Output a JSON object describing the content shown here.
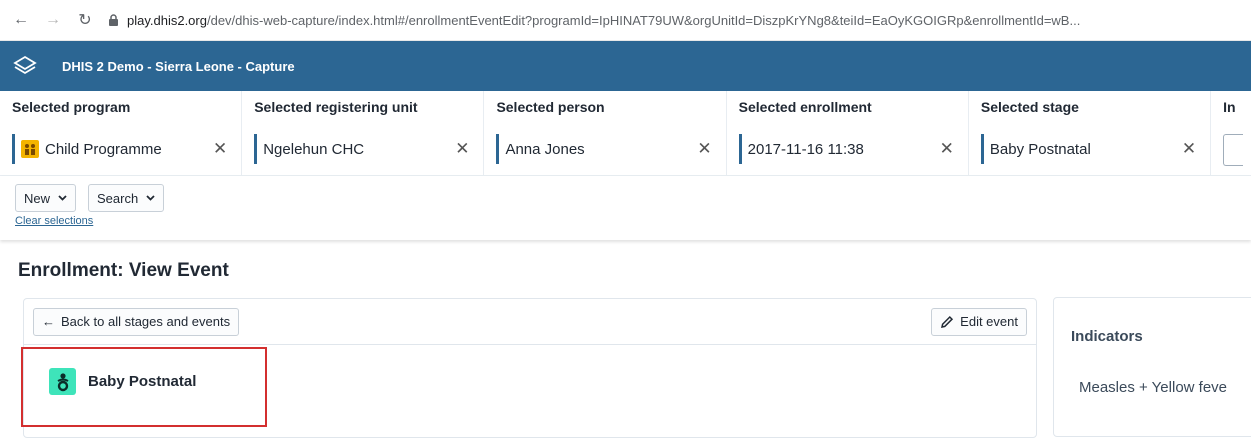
{
  "browser": {
    "url_host": "play.dhis2.org",
    "url_path": "/dev/dhis-web-capture/index.html#/enrollmentEventEdit?programId=IpHINAT79UW&orgUnitId=DiszpKrYNg8&teiId=EaOyKGOIGRp&enrollmentId=wB..."
  },
  "header": {
    "title": "DHIS 2 Demo - Sierra Leone - Capture"
  },
  "selections": [
    {
      "label": "Selected program",
      "value": "Child Programme"
    },
    {
      "label": "Selected registering unit",
      "value": "Ngelehun CHC"
    },
    {
      "label": "Selected person",
      "value": "Anna Jones"
    },
    {
      "label": "Selected enrollment",
      "value": "2017-11-16 11:38"
    },
    {
      "label": "Selected stage",
      "value": "Baby Postnatal"
    },
    {
      "label": "In",
      "value": ""
    }
  ],
  "actions": {
    "new_label": "New",
    "search_label": "Search",
    "clear_label": "Clear selections"
  },
  "page": {
    "title": "Enrollment: View Event"
  },
  "event_panel": {
    "back_label": "Back to all stages and events",
    "edit_label": "Edit event",
    "stage_name": "Baby Postnatal"
  },
  "indicators": {
    "title": "Indicators",
    "items": [
      "Measles + Yellow feve"
    ]
  },
  "colors": {
    "header": "#2c6693",
    "highlight": "#d32f2f",
    "stage_icon": "#3ee4ba",
    "program_icon": "#f4b400"
  }
}
